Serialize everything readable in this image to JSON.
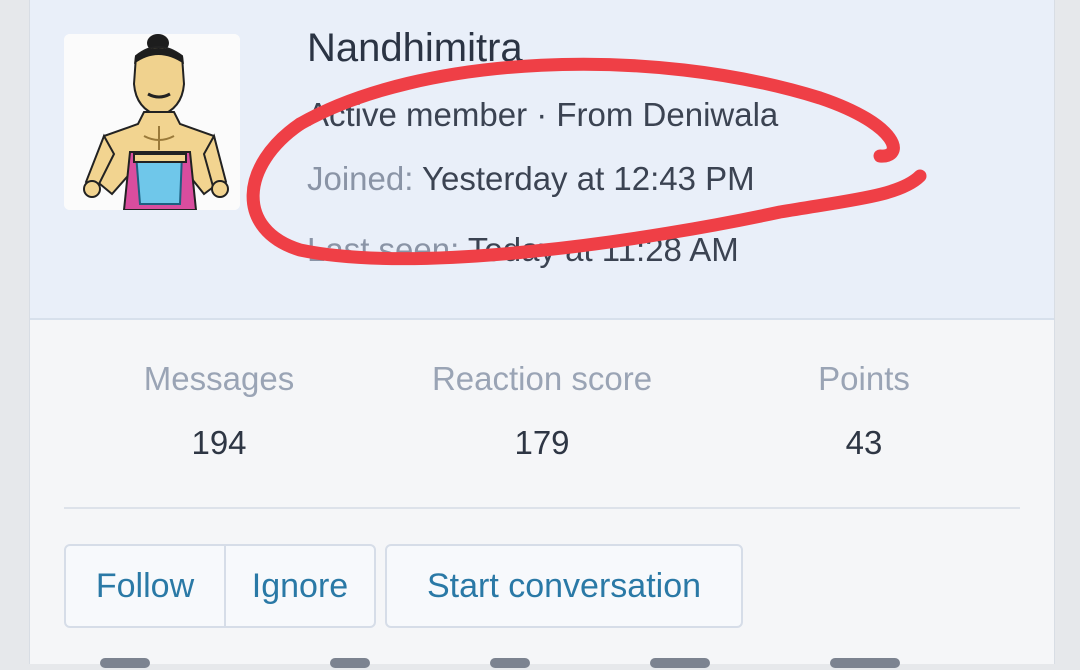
{
  "profile": {
    "name": "Nandhimitra",
    "subtitle": "Active member · From Deniwala",
    "joined": {
      "label": "Joined:",
      "value": "Yesterday at 12:43 PM"
    },
    "last_seen": {
      "label": "Last seen:",
      "value": "Today at 11:28 AM"
    }
  },
  "stats": [
    {
      "label": "Messages",
      "value": "194"
    },
    {
      "label": "Reaction score",
      "value": "179"
    },
    {
      "label": "Points",
      "value": "43"
    }
  ],
  "actions": {
    "follow": "Follow",
    "ignore": "Ignore",
    "start_conversation": "Start conversation"
  },
  "colors": {
    "header_bg": "#e9eff9",
    "button_text": "#2a79a6",
    "annotation": "#ef3f46"
  }
}
